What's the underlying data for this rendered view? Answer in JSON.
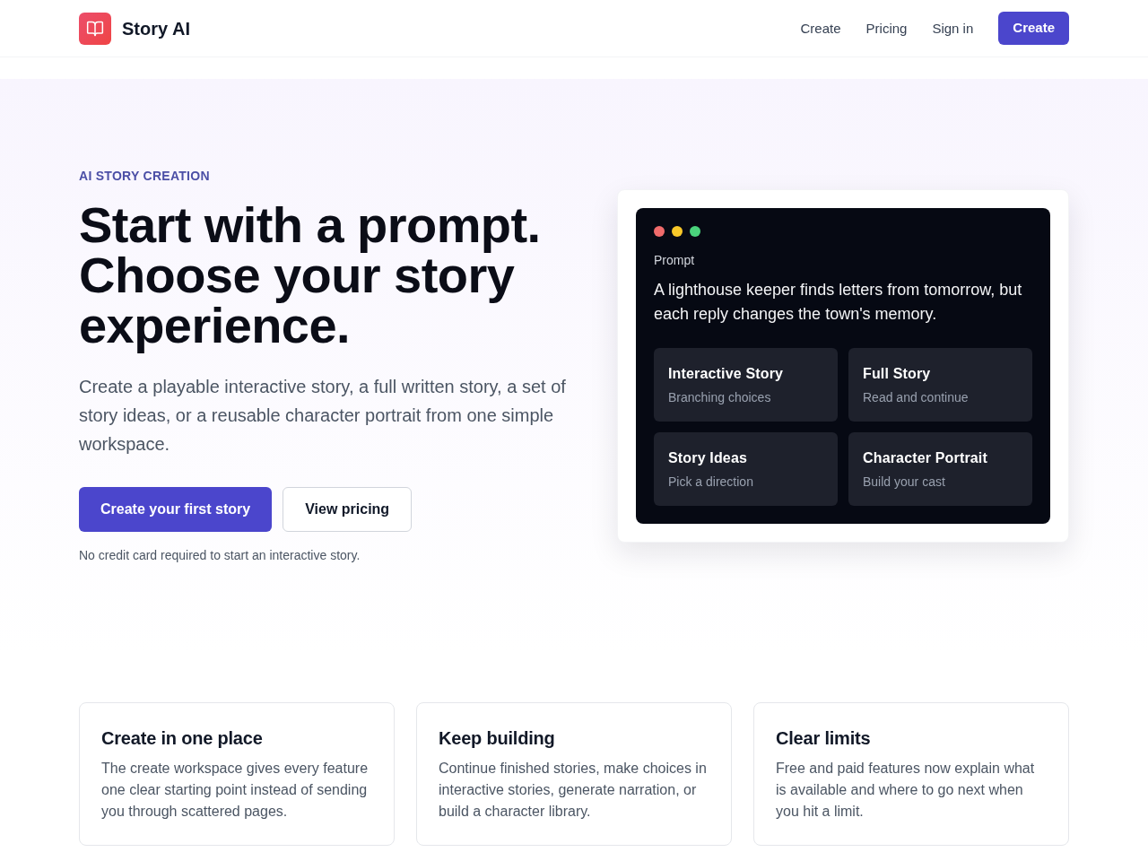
{
  "header": {
    "brand": "Story AI",
    "nav": [
      {
        "label": "Create"
      },
      {
        "label": "Pricing"
      },
      {
        "label": "Sign in"
      }
    ],
    "cta": "Create"
  },
  "hero": {
    "eyebrow": "AI STORY CREATION",
    "heading": "Start with a prompt. Choose your story experience.",
    "description": "Create a playable interactive story, a full written story, a set of story ideas, or a reusable character portrait from one simple workspace.",
    "buttons": [
      {
        "label": "Create your first story",
        "kind": "primary"
      },
      {
        "label": "View pricing",
        "kind": "secondary"
      }
    ],
    "note": "No credit card required to start an interactive story."
  },
  "preview": {
    "label": "Prompt",
    "prompt": "A lighthouse keeper finds letters from tomorrow, but each reply changes the town's memory.",
    "options": [
      {
        "title": "Interactive Story",
        "subtitle": "Branching choices"
      },
      {
        "title": "Full Story",
        "subtitle": "Read and continue"
      },
      {
        "title": "Story Ideas",
        "subtitle": "Pick a direction"
      },
      {
        "title": "Character Portrait",
        "subtitle": "Build your cast"
      }
    ]
  },
  "features": [
    {
      "title": "Create in one place",
      "description": "The create workspace gives every feature one clear starting point instead of sending you through scattered pages."
    },
    {
      "title": "Keep building",
      "description": "Continue finished stories, make choices in interactive stories, generate narration, or build a character library."
    },
    {
      "title": "Clear limits",
      "description": "Free and paid features now explain what is available and where to go next when you hit a limit."
    }
  ]
}
